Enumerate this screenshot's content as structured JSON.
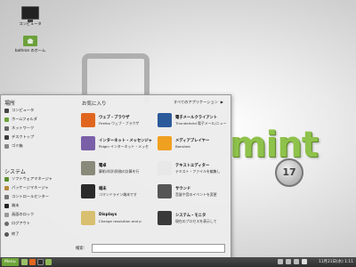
{
  "desktop": {
    "icons": [
      {
        "label": "コンピュータ"
      },
      {
        "label": "bathron のホーム"
      }
    ]
  },
  "logo": {
    "text": "mint",
    "badge": "17"
  },
  "menu": {
    "places_title": "場所",
    "places": [
      {
        "label": "コンピュータ"
      },
      {
        "label": "ホームフォルダ"
      },
      {
        "label": "ネットワーク"
      },
      {
        "label": "デスクトップ"
      },
      {
        "label": "ゴミ箱"
      }
    ],
    "system_title": "システム",
    "system": [
      {
        "label": "ソフトウェアマネージャ"
      },
      {
        "label": "パッケージマネージャ"
      },
      {
        "label": "コントロールセンター"
      },
      {
        "label": "端末"
      },
      {
        "label": "画面のロック"
      },
      {
        "label": "ログアウト"
      },
      {
        "label": "終了"
      }
    ],
    "favorites_title": "お気に入り",
    "all_apps_label": "すべてのアプリケーション",
    "all_apps_arrow": "▶",
    "apps": [
      {
        "name": "ウェブ・ブラウザ",
        "desc": "Firefox ウェブ・ブラウザ",
        "color": "#e0661f"
      },
      {
        "name": "電子メールクライアント",
        "desc": "Thunderbird 電子メール/ニュー",
        "color": "#2b5a9a"
      },
      {
        "name": "インターネット・メッセンジャ",
        "desc": "Pidgin インターネット・メッセ",
        "color": "#7a5fa8"
      },
      {
        "name": "メディアプレイヤー",
        "desc": "Banshee",
        "color": "#f0a020"
      },
      {
        "name": "電卓",
        "desc": "算術/科学/財務の計算を行",
        "color": "#8a8a7a"
      },
      {
        "name": "テキストエディター",
        "desc": "テキスト・ファイルを編集し",
        "color": "#e8e8e8"
      },
      {
        "name": "端末",
        "desc": "コマンドライン端末です",
        "color": "#2b2b2b"
      },
      {
        "name": "サウンド",
        "desc": "音量や音のイベントを変更",
        "color": "#555555"
      },
      {
        "name": "Displays",
        "desc": "Change resolution and p",
        "color": "#d8c070"
      },
      {
        "name": "システム・モニタ",
        "desc": "現在のプロセスを表示して",
        "color": "#3a3a3a"
      }
    ],
    "search_label": "検索:",
    "search_value": ""
  },
  "panel": {
    "menu_label": "Menu",
    "clock": "11月21日(水) 1:11"
  }
}
